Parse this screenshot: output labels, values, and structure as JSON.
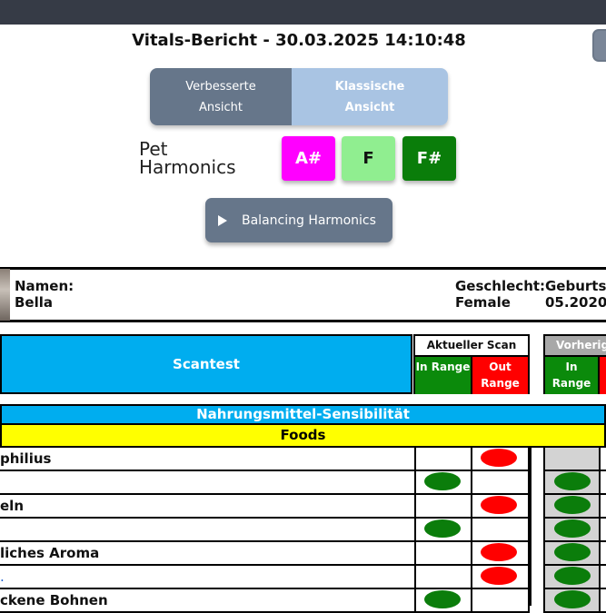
{
  "report": {
    "title": "Vitals-Bericht - 30.03.2025 14:10:48"
  },
  "view_toggle": {
    "improved": "Verbesserte Ansicht",
    "classic": "Klassische Ansicht"
  },
  "pet_harmonics": {
    "label": "Pet Harmonics",
    "notes": [
      {
        "label": "A#",
        "color": "#ff00ff"
      },
      {
        "label": "F",
        "color": "#90ee90"
      },
      {
        "label": "F#",
        "color": "#0a7d0a"
      }
    ],
    "play_label": "Balancing Harmonics"
  },
  "patient": {
    "name_label": "Namen:",
    "name": "Bella",
    "gender_label": "Geschlecht:",
    "gender": "Female",
    "birth_label": "Geburtsd",
    "birth_value": "05.2020"
  },
  "scan": {
    "title": "Scantest",
    "current_header": "Aktueller Scan",
    "previous_header": "Vorherig",
    "in_range": "In Range",
    "out_range": "Out Range",
    "in_color": "#0b8a0b",
    "out_color": "#ff0000"
  },
  "section": {
    "title": "Nahrungsmittel-Sensibilität",
    "category": "Foods"
  },
  "rows": [
    {
      "name": "philius",
      "status": "out",
      "previous": ""
    },
    {
      "name": "",
      "status": "in",
      "previous": "in"
    },
    {
      "name": "eln",
      "status": "out",
      "previous": "in"
    },
    {
      "name": "",
      "status": "in",
      "previous": "in"
    },
    {
      "name": "liches Aroma",
      "status": "out",
      "previous": "in"
    },
    {
      "name": "",
      "status": "out",
      "previous": "in"
    },
    {
      "name": "ckene Bohnen",
      "status": "in",
      "previous": "in"
    }
  ]
}
